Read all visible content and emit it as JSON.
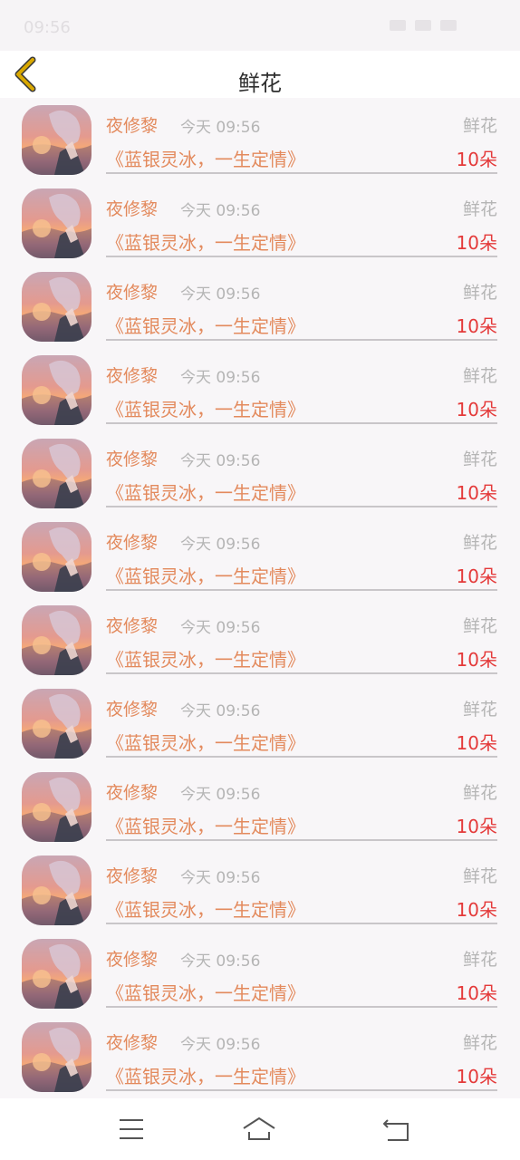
{
  "status_bar": {
    "time": "09:56"
  },
  "header": {
    "title": "鲜花"
  },
  "items": [
    {
      "name": "夜修黎",
      "time": "今天 09:56",
      "gift_type": "鲜花",
      "message": "《蓝银灵冰，一生定情》",
      "count": "10朵"
    },
    {
      "name": "夜修黎",
      "time": "今天 09:56",
      "gift_type": "鲜花",
      "message": "《蓝银灵冰，一生定情》",
      "count": "10朵"
    },
    {
      "name": "夜修黎",
      "time": "今天 09:56",
      "gift_type": "鲜花",
      "message": "《蓝银灵冰，一生定情》",
      "count": "10朵"
    },
    {
      "name": "夜修黎",
      "time": "今天 09:56",
      "gift_type": "鲜花",
      "message": "《蓝银灵冰，一生定情》",
      "count": "10朵"
    },
    {
      "name": "夜修黎",
      "time": "今天 09:56",
      "gift_type": "鲜花",
      "message": "《蓝银灵冰，一生定情》",
      "count": "10朵"
    },
    {
      "name": "夜修黎",
      "time": "今天 09:56",
      "gift_type": "鲜花",
      "message": "《蓝银灵冰，一生定情》",
      "count": "10朵"
    },
    {
      "name": "夜修黎",
      "time": "今天 09:56",
      "gift_type": "鲜花",
      "message": "《蓝银灵冰，一生定情》",
      "count": "10朵"
    },
    {
      "name": "夜修黎",
      "time": "今天 09:56",
      "gift_type": "鲜花",
      "message": "《蓝银灵冰，一生定情》",
      "count": "10朵"
    },
    {
      "name": "夜修黎",
      "time": "今天 09:56",
      "gift_type": "鲜花",
      "message": "《蓝银灵冰，一生定情》",
      "count": "10朵"
    },
    {
      "name": "夜修黎",
      "time": "今天 09:56",
      "gift_type": "鲜花",
      "message": "《蓝银灵冰，一生定情》",
      "count": "10朵"
    },
    {
      "name": "夜修黎",
      "time": "今天 09:56",
      "gift_type": "鲜花",
      "message": "《蓝银灵冰，一生定情》",
      "count": "10朵"
    },
    {
      "name": "夜修黎",
      "time": "今天 09:56",
      "gift_type": "鲜花",
      "message": "《蓝银灵冰，一生定情》",
      "count": "10朵"
    }
  ],
  "icons": {
    "back": "chevron-left-icon",
    "menu": "menu-icon",
    "home": "home-icon",
    "return": "return-icon"
  },
  "colors": {
    "accent": "#e38a5d",
    "count": "#e43a3a",
    "back_icon": "#d9a800",
    "muted": "#b5b5b5"
  }
}
